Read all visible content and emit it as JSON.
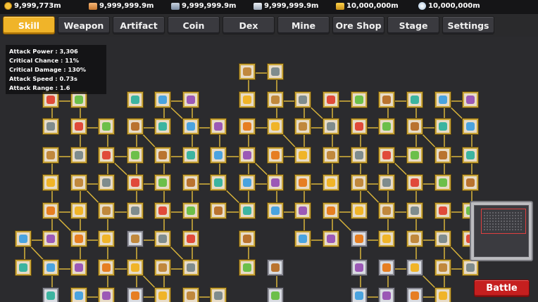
{
  "resources": [
    {
      "icon": "coin-icon",
      "value": "9,999,773m"
    },
    {
      "icon": "copper-bar-icon",
      "value": "9,999,999.9m"
    },
    {
      "icon": "iron-bar-icon",
      "value": "9,999,999.9m"
    },
    {
      "icon": "silver-bar-icon",
      "value": "9,999,999.9m"
    },
    {
      "icon": "gold-bar-icon",
      "value": "10,000,000m"
    },
    {
      "icon": "diamond-icon",
      "value": "10,000,000m"
    }
  ],
  "tabs": [
    "Skill",
    "Weapon",
    "Artifact",
    "Coin",
    "Dex",
    "Mine",
    "Ore Shop",
    "Stage",
    "Settings"
  ],
  "active_tab": "Skill",
  "stats": {
    "attack_power": "Attack Power : 3,306",
    "critical_chance": "Critical Chance : 11%",
    "critical_damage": "Critical Damage : 130%",
    "attack_speed": "Attack Speed : 0.73s",
    "attack_range": "Attack Range : 1.6"
  },
  "battle_label": "Battle",
  "colors": {
    "active_tab": "#f0b429",
    "tab": "#3a3a3f",
    "node_border_unlocked": "#caa63a",
    "node_border_locked": "#8c8c95",
    "battle_button": "#c51f1f"
  }
}
